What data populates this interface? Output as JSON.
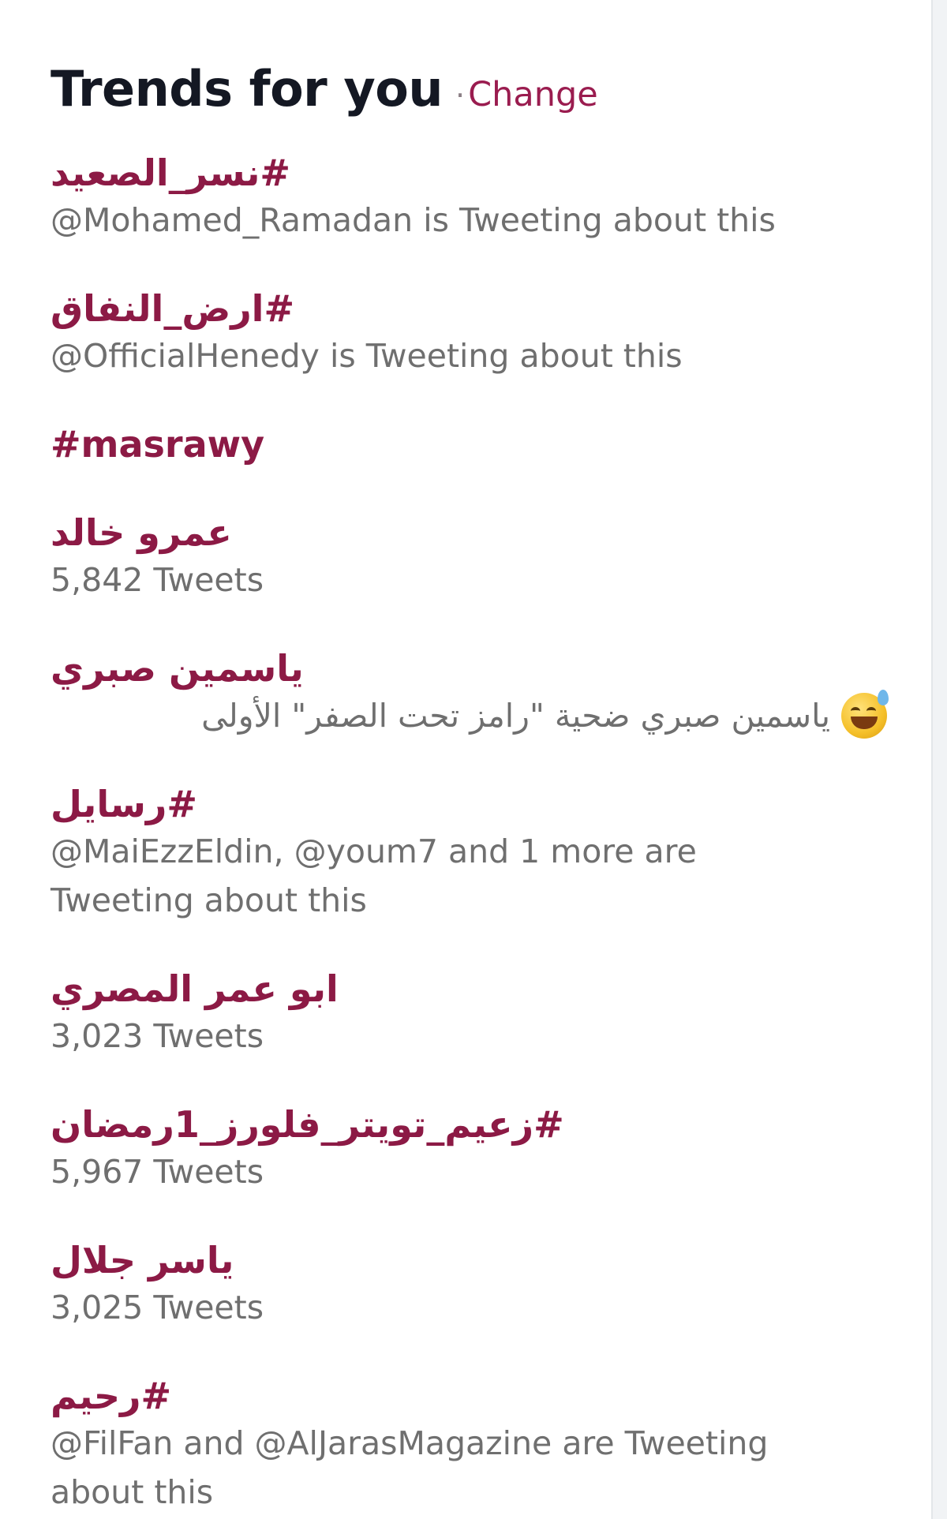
{
  "header": {
    "title": "Trends for you",
    "separator": "·",
    "change_label": "Change"
  },
  "trends": [
    {
      "name": "#نسر_الصعيد",
      "meta": "@Mohamed_Ramadan is Tweeting about this"
    },
    {
      "name": "#ارض_النفاق",
      "meta": "@OfficialHenedy is Tweeting about this"
    },
    {
      "name": "#masrawy",
      "meta": ""
    },
    {
      "name": "عمرو خالد",
      "meta": "5,842 Tweets"
    },
    {
      "name": "ياسمين صبري",
      "meta": "ياسمين صبري ضحية \"رامز تحت الصفر\" الأولى",
      "meta_icon": "grinning-sweat-emoji-icon"
    },
    {
      "name": "#رسايل",
      "meta": "@MaiEzzEldin, @youm7 and 1 more are Tweeting about this"
    },
    {
      "name": "ابو عمر المصري",
      "meta": "3,023 Tweets"
    },
    {
      "name": "#زعيم_تويتر_فلورز_1رمضان",
      "meta": "5,967 Tweets"
    },
    {
      "name": "ياسر جلال",
      "meta": "3,025 Tweets"
    },
    {
      "name": "#رحيم",
      "meta": "@FilFan and @AlJarasMagazine are Tweeting about this"
    }
  ],
  "colors": {
    "trend_name": "#8c1a45",
    "link": "#9a1c4f",
    "meta": "#6f6f6f",
    "title": "#141823"
  }
}
